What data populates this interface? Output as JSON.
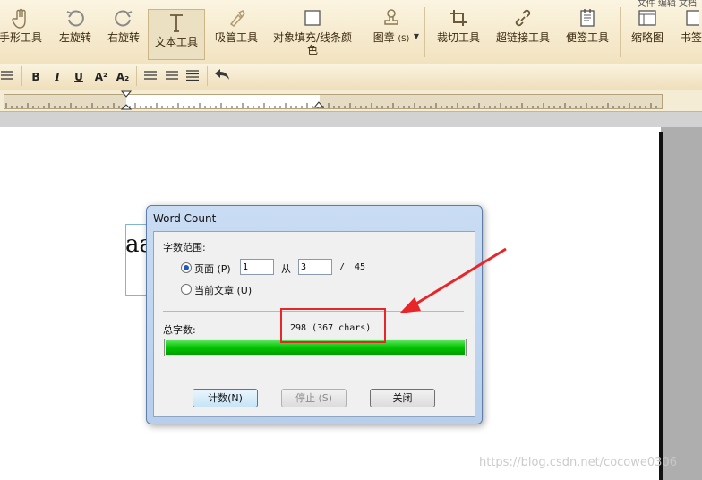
{
  "toolbar": {
    "menu_fragment": "文件  编辑  文档",
    "tools": [
      {
        "label": "手形工具",
        "icon": "hand-icon"
      },
      {
        "label": "左旋转",
        "icon": "rotate-left-icon"
      },
      {
        "label": "右旋转",
        "icon": "rotate-right-icon"
      },
      {
        "label": "文本工具",
        "icon": "text-tool-icon"
      },
      {
        "label": "吸管工具",
        "icon": "eyedropper-icon"
      },
      {
        "label": "对象填充/线条颜",
        "label2": "色",
        "icon": "fill-color-icon"
      },
      {
        "label": "图章",
        "suffix": "(S)",
        "icon": "stamp-icon"
      },
      {
        "label": "裁切工具",
        "icon": "crop-icon"
      },
      {
        "label": "超链接工具",
        "icon": "link-icon"
      },
      {
        "label": "便签工具",
        "icon": "note-icon"
      },
      {
        "label": "缩略图",
        "icon": "thumbnail-icon"
      },
      {
        "label": "书签",
        "icon": "bookmark-icon"
      }
    ]
  },
  "format_bar": {
    "bold": "B",
    "italic": "I",
    "underline": "U",
    "superscript": "A²",
    "subscript": "A₂"
  },
  "document": {
    "text": "aa"
  },
  "dialog": {
    "title": "Word Count",
    "range_label": "字数范围:",
    "page_option": "页面 (P)",
    "page_from": "1",
    "from_label": "从",
    "page_to": "3",
    "slash": "/",
    "total_pages": "45",
    "current_article_option": "当前文章 (U)",
    "total_label": "总字数:",
    "total_value": "298 (367 chars)",
    "progress": 1.0,
    "buttons": {
      "count": "计数(N)",
      "stop": "停止 (S)",
      "close": "关闭"
    }
  },
  "annotation": {
    "color": "#e8262a"
  },
  "watermark": "https://blog.csdn.net/cocowe0306"
}
